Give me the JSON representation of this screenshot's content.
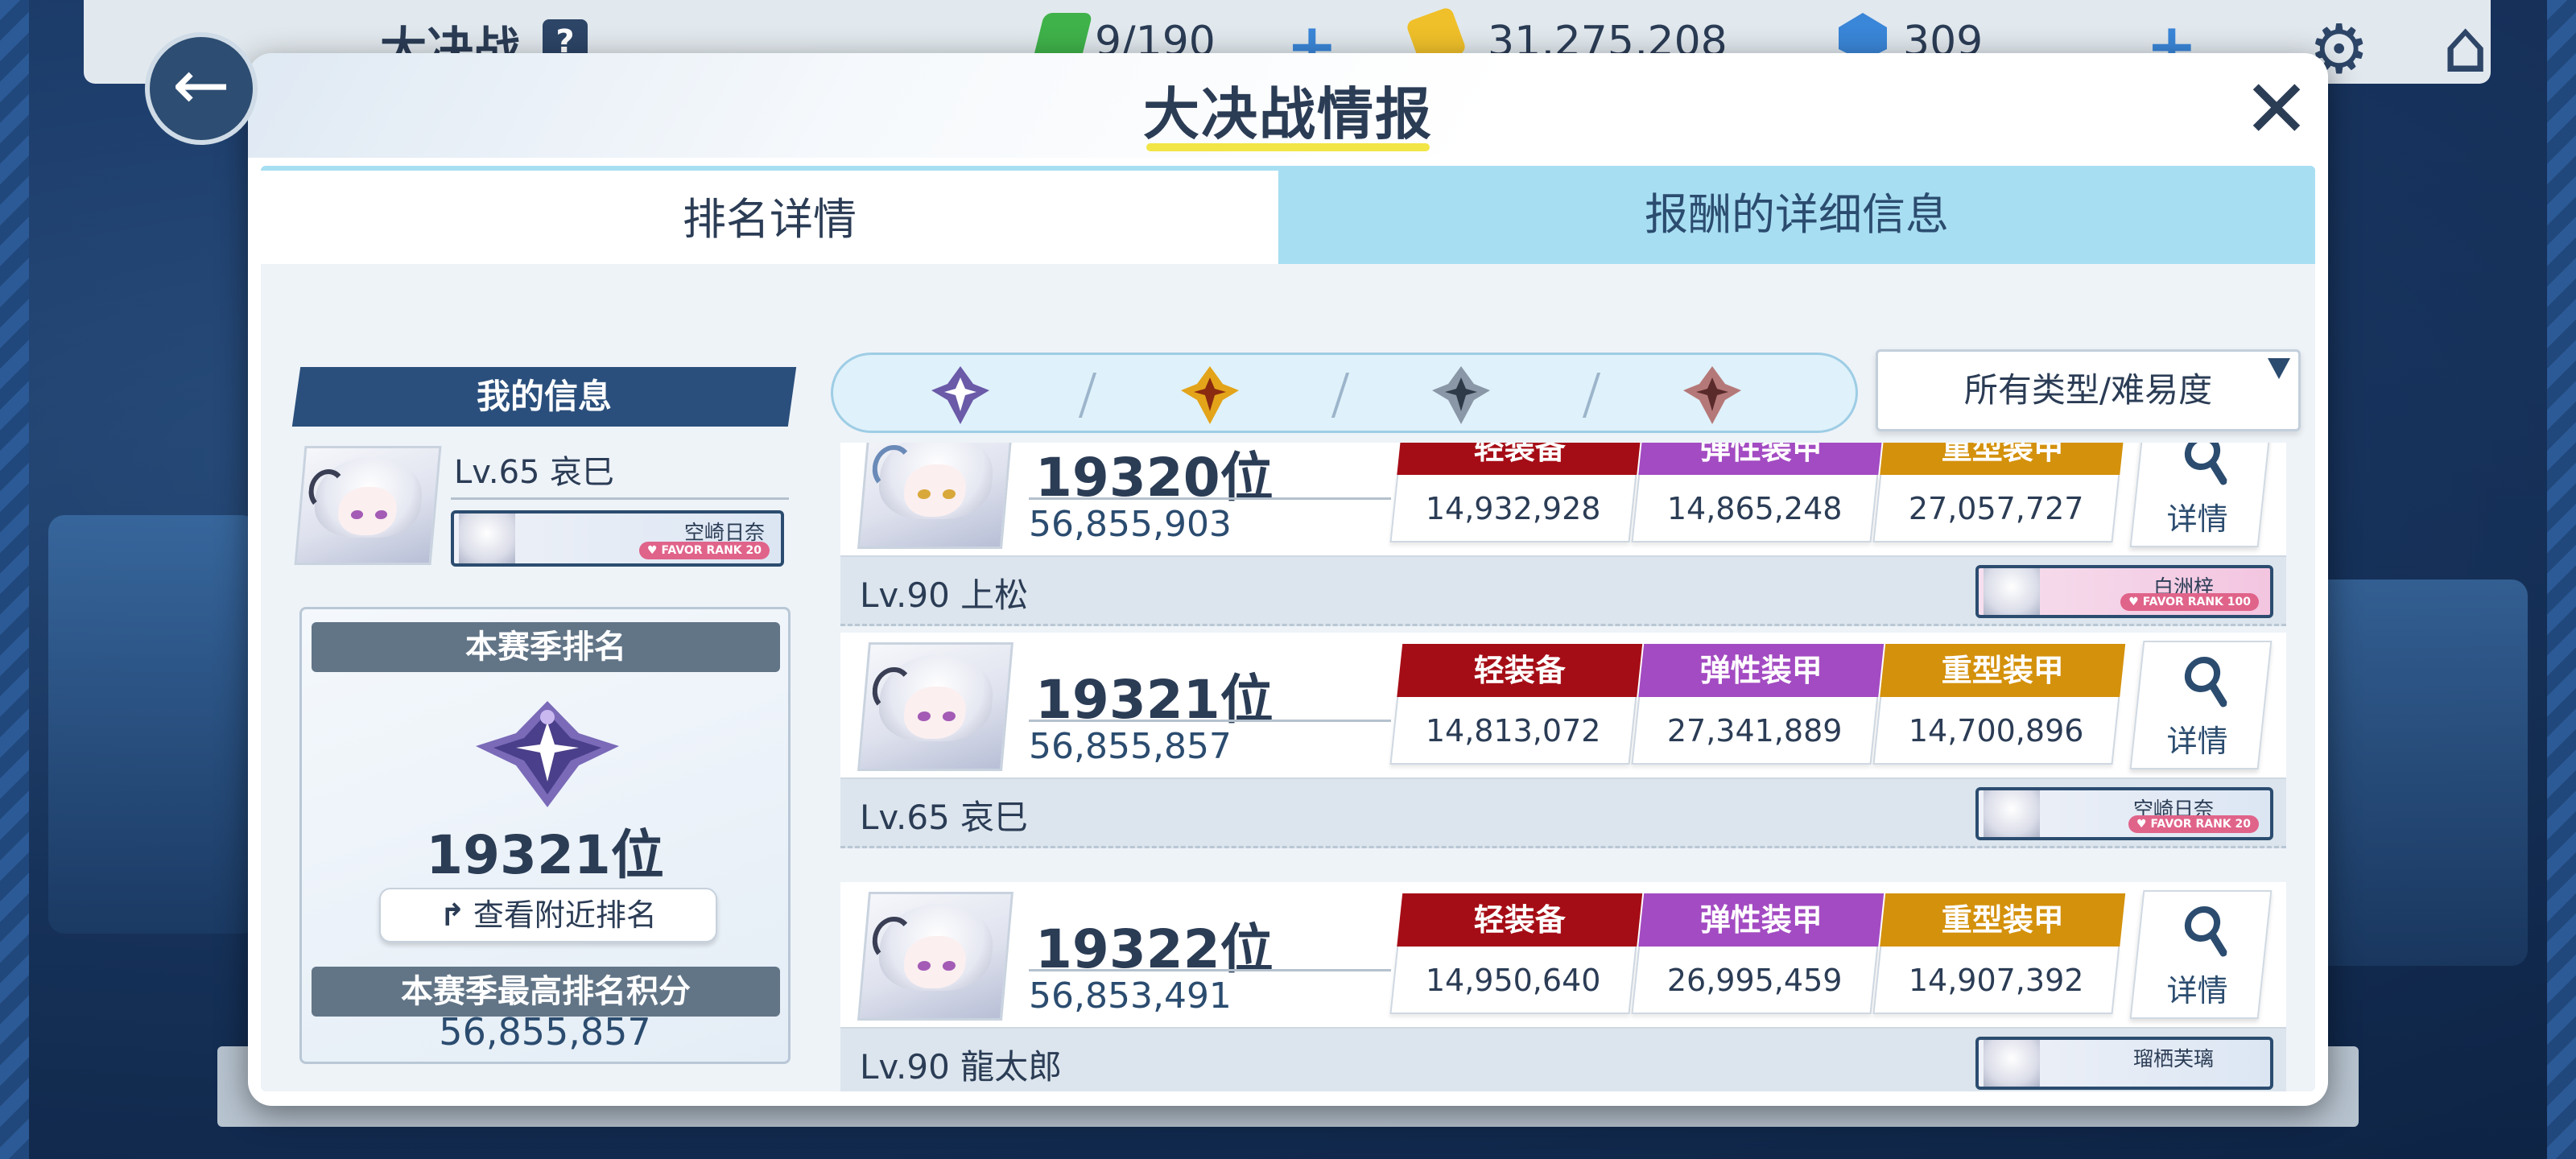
{
  "hud": {
    "title": "大决战",
    "help": "?",
    "stamina": "9/190",
    "credits": "31,275,208",
    "gems": "309",
    "plus": "+"
  },
  "modal": {
    "title": "大决战情报",
    "close": "✕"
  },
  "tabs": [
    {
      "label": "排名详情",
      "active": true
    },
    {
      "label": "报酬的详细信息",
      "active": false
    }
  ],
  "my_info": {
    "header": "我的信息",
    "level_name": "Lv.65  哀巳",
    "favor_student": "空崎日奈",
    "favor_rank": "♥ FAVOR RANK 20"
  },
  "season": {
    "rank_label": "本赛季排名",
    "rank": "19321位",
    "nearby_button": "查看附近排名",
    "best_label": "本赛季最高排名积分",
    "best_score": "56,855,857"
  },
  "filters": {
    "tiers": [
      "platinum",
      "gold",
      "silver",
      "bronze"
    ],
    "type_dropdown": "所有类型/难易度"
  },
  "colors": {
    "accent_blue": "#2a4f7c",
    "tag_light": "#a50d16",
    "tag_elastic": "#a34bc2",
    "tag_heavy": "#d4910c"
  },
  "labels": {
    "light": "轻装备",
    "elastic": "弹性装甲",
    "heavy": "重型装甲",
    "detail": "详情"
  },
  "ranking": [
    {
      "rank": "19320位",
      "score": "56,855,903",
      "light": "14,932,928",
      "elastic": "14,865,248",
      "heavy": "27,057,727",
      "level_name": "Lv.90  上松",
      "favor_student": "白洲梓",
      "favor_rank": "♥ FAVOR RANK 100",
      "favor_style": "pink"
    },
    {
      "rank": "19321位",
      "score": "56,855,857",
      "light": "14,813,072",
      "elastic": "27,341,889",
      "heavy": "14,700,896",
      "level_name": "Lv.65  哀巳",
      "favor_student": "空崎日奈",
      "favor_rank": "♥ FAVOR RANK 20",
      "favor_style": "blue"
    },
    {
      "rank": "19322位",
      "score": "56,853,491",
      "light": "14,950,640",
      "elastic": "26,995,459",
      "heavy": "14,907,392",
      "level_name": "Lv.90  龍太郎",
      "favor_student": "瑠栖芙璃",
      "favor_rank": "",
      "favor_style": "blue"
    }
  ]
}
